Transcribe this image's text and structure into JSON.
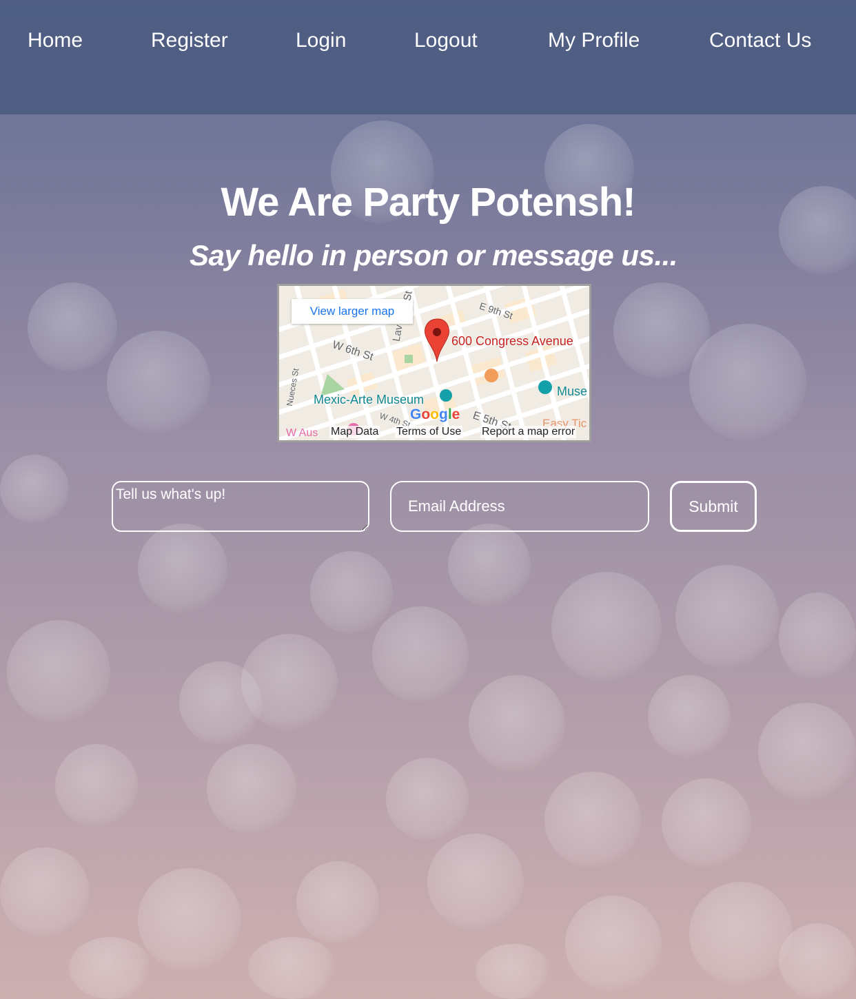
{
  "nav": {
    "items": [
      {
        "label": "Home"
      },
      {
        "label": "Register"
      },
      {
        "label": "Login"
      },
      {
        "label": "Logout"
      },
      {
        "label": "My Profile"
      },
      {
        "label": "Contact Us"
      }
    ]
  },
  "hero": {
    "title": "We Are Party Potensh!",
    "subtitle": "Say hello in person or message us..."
  },
  "map": {
    "view_larger": "View larger map",
    "address": "600 Congress Avenue",
    "museum": "Mexic-Arte Museum",
    "museum2": "Muse",
    "streets": {
      "e9th": "E 9th St",
      "w6th": "W 6th St",
      "nueces": "Nueces St",
      "w4th": "W 4th St",
      "e5th": "E 5th St",
      "lav": "Lav",
      "st": "St"
    },
    "waus": "W Aus",
    "easy": "Easy Tic",
    "google": "Google",
    "footer": {
      "map_data": "Map Data",
      "terms": "Terms of Use",
      "report": "Report a map error"
    }
  },
  "form": {
    "message_placeholder": "Tell us what's up!",
    "email_placeholder": "Email Address",
    "submit_label": "Submit"
  },
  "colors": {
    "nav_bg": "#4e5c82",
    "pin": "#ea4335",
    "accent_link": "#1a73e8"
  }
}
